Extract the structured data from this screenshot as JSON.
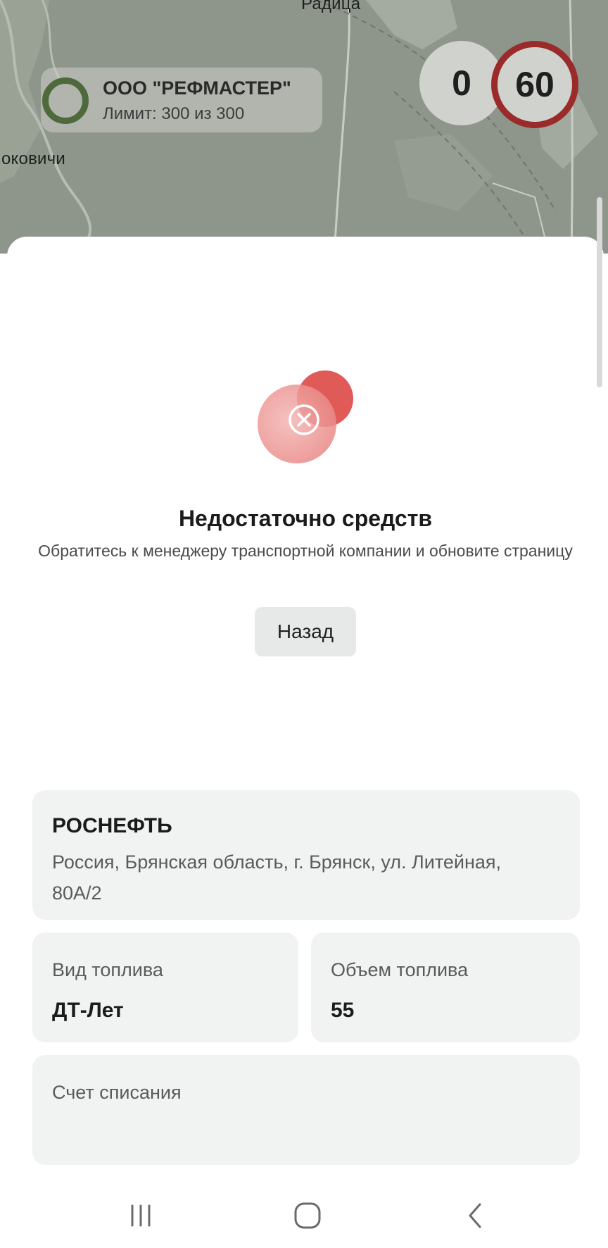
{
  "map": {
    "place_top": "Радица",
    "place_left": "оковичи"
  },
  "company": {
    "name": "ООО \"РЕФМАСТЕР\"",
    "limit_text": "Лимит: 300 из 300",
    "status_color": "#4e6a3c"
  },
  "speed": {
    "current": "0",
    "limit": "60",
    "limit_border_color": "#9b2b2b"
  },
  "error": {
    "icon": "close-circle-icon",
    "accent_color": "#e05a57",
    "title": "Недостаточно средств",
    "message": "Обратитесь к менеджеру транспортной компании и обновите страницу"
  },
  "actions": {
    "back_label": "Назад"
  },
  "station": {
    "name": "РОСНЕФТЬ",
    "address": "Россия, Брянская область, г. Брянск, ул. Литейная, 80А/2"
  },
  "fuel": {
    "type_label": "Вид топлива",
    "type_value": "ДТ-Лет",
    "volume_label": "Объем топлива",
    "volume_value": "55"
  },
  "account": {
    "label": "Счет списания"
  },
  "nav": {
    "recents_icon": "recents-icon",
    "home_icon": "home-icon",
    "back_icon": "back-icon"
  }
}
